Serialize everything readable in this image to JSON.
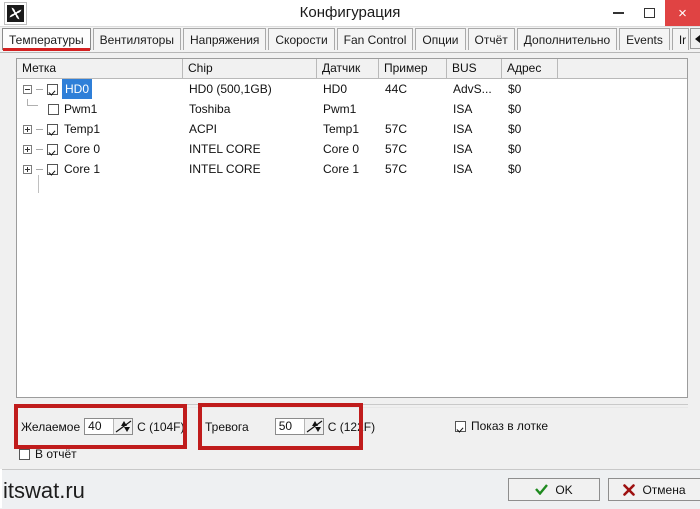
{
  "window": {
    "title": "Конфигурация",
    "app_icon": "fan-icon",
    "controls": {
      "minimize": "minimize-icon",
      "maximize": "maximize-icon",
      "close": "×"
    }
  },
  "tabs": {
    "selected_index": 0,
    "items": [
      {
        "label": "Температуры"
      },
      {
        "label": "Вентиляторы"
      },
      {
        "label": "Напряжения"
      },
      {
        "label": "Скорости"
      },
      {
        "label": "Fan Control"
      },
      {
        "label": "Опции"
      },
      {
        "label": "Отчёт"
      },
      {
        "label": "Дополнительно"
      },
      {
        "label": "Events"
      },
      {
        "label": "Ir"
      }
    ],
    "scroll_left": "◀",
    "scroll_right": "▶"
  },
  "grid": {
    "columns": [
      {
        "key": "label",
        "title": "Метка"
      },
      {
        "key": "chip",
        "title": "Chip"
      },
      {
        "key": "sensor",
        "title": "Датчик"
      },
      {
        "key": "sample",
        "title": "Пример"
      },
      {
        "key": "bus",
        "title": "BUS"
      },
      {
        "key": "addr",
        "title": "Адрес"
      }
    ],
    "rows": [
      {
        "label": "HD0",
        "chip": "HD0 (500,1GB)",
        "sensor": "HD0",
        "sample": "44C",
        "bus": "AdvS...",
        "addr": "$0",
        "checked": true,
        "selected": true,
        "depth": 0,
        "twisty": "minus"
      },
      {
        "label": "Pwm1",
        "chip": "Toshiba",
        "sensor": "Pwm1",
        "sample": "",
        "bus": "ISA",
        "addr": "$0",
        "checked": false,
        "selected": false,
        "depth": 1,
        "twisty": "none"
      },
      {
        "label": "Temp1",
        "chip": "ACPI",
        "sensor": "Temp1",
        "sample": "57C",
        "bus": "ISA",
        "addr": "$0",
        "checked": true,
        "selected": false,
        "depth": 0,
        "twisty": "plus"
      },
      {
        "label": "Core 0",
        "chip": "INTEL CORE",
        "sensor": "Core 0",
        "sample": "57C",
        "bus": "ISA",
        "addr": "$0",
        "checked": true,
        "selected": false,
        "depth": 0,
        "twisty": "plus"
      },
      {
        "label": "Core 1",
        "chip": "INTEL CORE",
        "sensor": "Core 1",
        "sample": "57C",
        "bus": "ISA",
        "addr": "$0",
        "checked": true,
        "selected": false,
        "depth": 0,
        "twisty": "plus"
      }
    ]
  },
  "settings": {
    "desired": {
      "label": "Желаемое",
      "value": "40",
      "suffix": "C (104F)",
      "spinner": "spin-up-down-icon"
    },
    "alarm": {
      "label": "Тревога",
      "value": "50",
      "suffix": "C (122F)",
      "spinner": "spin-up-down-icon"
    },
    "report_checkbox": {
      "label": "В отчёт",
      "checked": false
    },
    "tray_checkbox": {
      "label": "Показ в лотке",
      "checked": true
    }
  },
  "footer": {
    "ok": {
      "label": "OK",
      "icon": "check-icon"
    },
    "cancel": {
      "label": "Отмена",
      "icon": "cross-icon"
    }
  },
  "watermark": "itswat.ru",
  "colors": {
    "accent_red": "#c01c1c",
    "close_red": "#e04343",
    "selection_blue": "#2f7fd8",
    "ok_green": "#1f8a1f",
    "cancel_red": "#9e1111"
  }
}
